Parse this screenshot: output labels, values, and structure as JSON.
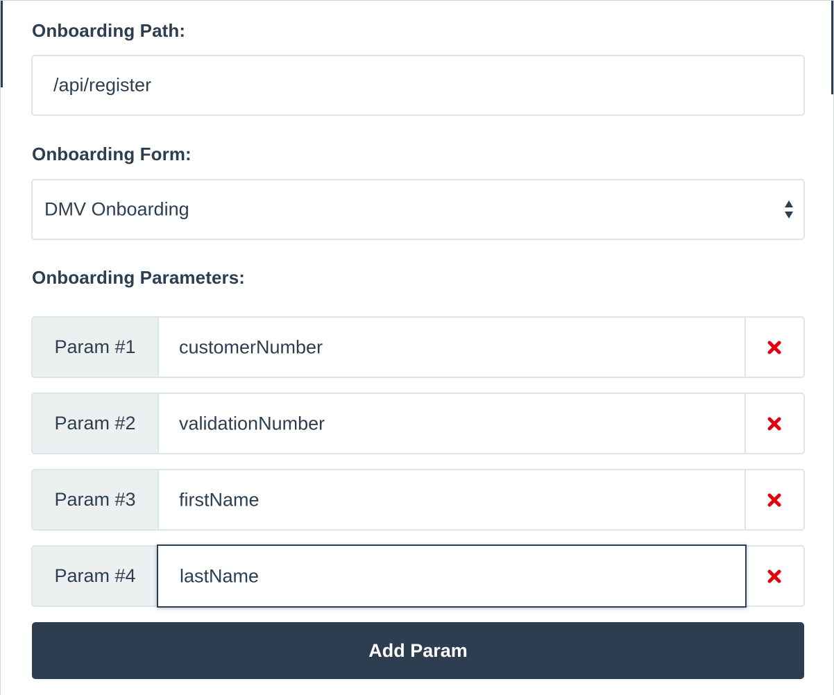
{
  "onboarding_path": {
    "label": "Onboarding Path:",
    "value": "/api/register"
  },
  "onboarding_form": {
    "label": "Onboarding Form:",
    "selected": "DMV Onboarding",
    "icon": "select-arrows-icon"
  },
  "onboarding_parameters": {
    "label": "Onboarding Parameters:",
    "params": [
      {
        "addon": "Param #1",
        "value": "customerNumber",
        "remove_icon": "close-icon"
      },
      {
        "addon": "Param #2",
        "value": "validationNumber",
        "remove_icon": "close-icon"
      },
      {
        "addon": "Param #3",
        "value": "firstName",
        "remove_icon": "close-icon"
      },
      {
        "addon": "Param #4",
        "value": "lastName",
        "remove_icon": "close-icon",
        "focused": true
      }
    ]
  },
  "add_button": {
    "label": "Add Param"
  },
  "colors": {
    "primary": "#2c3e50",
    "border": "#dce4ec",
    "addon_bg": "#ecf0f1",
    "remove": "#e3000f"
  }
}
